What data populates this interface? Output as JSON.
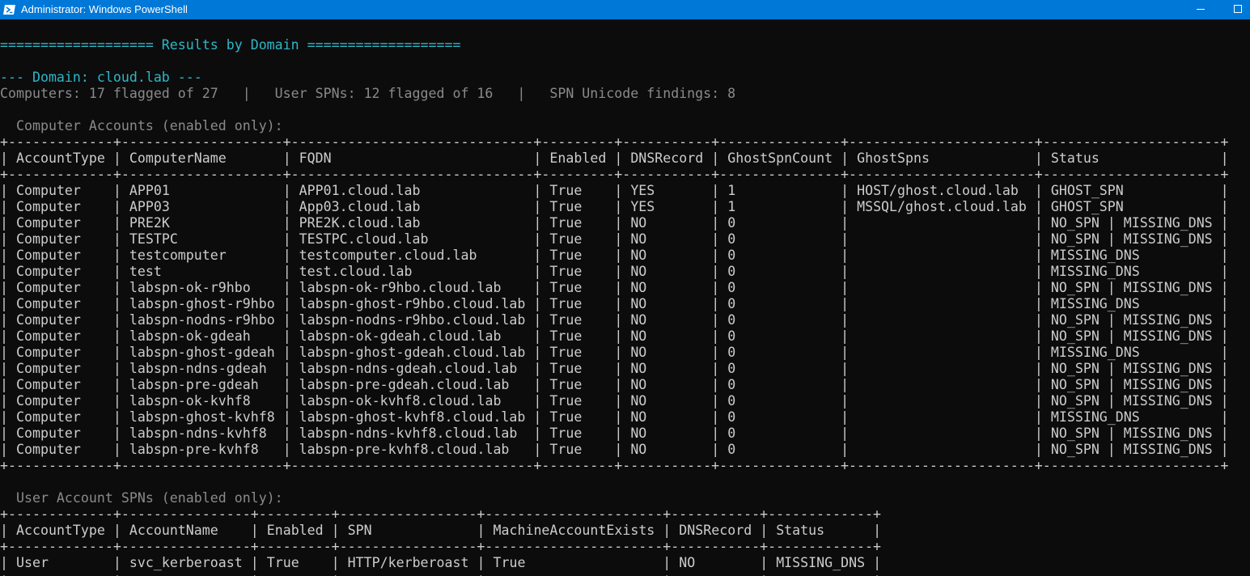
{
  "window": {
    "title": "Administrator: Windows PowerShell"
  },
  "console": {
    "results_header": "=================== Results by Domain ===================",
    "domain_header": "--- Domain: cloud.lab ---",
    "summary": "Computers: 17 flagged of 27   |   User SPNs: 12 flagged of 16   |   SPN Unicode findings: 8",
    "computer_section_title": "  Computer Accounts (enabled only):",
    "user_section_title": "  User Account SPNs (enabled only):",
    "computer_table": {
      "headers": [
        "AccountType",
        "ComputerName",
        "FQDN",
        "Enabled",
        "DNSRecord",
        "GhostSpnCount",
        "GhostSpns",
        "Status"
      ],
      "rows": [
        [
          "Computer",
          "APP01",
          "APP01.cloud.lab",
          "True",
          "YES",
          "1",
          "HOST/ghost.cloud.lab",
          "GHOST_SPN"
        ],
        [
          "Computer",
          "APP03",
          "App03.cloud.lab",
          "True",
          "YES",
          "1",
          "MSSQL/ghost.cloud.lab",
          "GHOST_SPN"
        ],
        [
          "Computer",
          "PRE2K",
          "PRE2K.cloud.lab",
          "True",
          "NO",
          "0",
          "",
          "NO_SPN | MISSING_DNS"
        ],
        [
          "Computer",
          "TESTPC",
          "TESTPC.cloud.lab",
          "True",
          "NO",
          "0",
          "",
          "NO_SPN | MISSING_DNS"
        ],
        [
          "Computer",
          "testcomputer",
          "testcomputer.cloud.lab",
          "True",
          "NO",
          "0",
          "",
          "MISSING_DNS"
        ],
        [
          "Computer",
          "test",
          "test.cloud.lab",
          "True",
          "NO",
          "0",
          "",
          "MISSING_DNS"
        ],
        [
          "Computer",
          "labspn-ok-r9hbo",
          "labspn-ok-r9hbo.cloud.lab",
          "True",
          "NO",
          "0",
          "",
          "NO_SPN | MISSING_DNS"
        ],
        [
          "Computer",
          "labspn-ghost-r9hbo",
          "labspn-ghost-r9hbo.cloud.lab",
          "True",
          "NO",
          "0",
          "",
          "MISSING_DNS"
        ],
        [
          "Computer",
          "labspn-nodns-r9hbo",
          "labspn-nodns-r9hbo.cloud.lab",
          "True",
          "NO",
          "0",
          "",
          "NO_SPN | MISSING_DNS"
        ],
        [
          "Computer",
          "labspn-ok-gdeah",
          "labspn-ok-gdeah.cloud.lab",
          "True",
          "NO",
          "0",
          "",
          "NO_SPN | MISSING_DNS"
        ],
        [
          "Computer",
          "labspn-ghost-gdeah",
          "labspn-ghost-gdeah.cloud.lab",
          "True",
          "NO",
          "0",
          "",
          "MISSING_DNS"
        ],
        [
          "Computer",
          "labspn-ndns-gdeah",
          "labspn-ndns-gdeah.cloud.lab",
          "True",
          "NO",
          "0",
          "",
          "NO_SPN | MISSING_DNS"
        ],
        [
          "Computer",
          "labspn-pre-gdeah",
          "labspn-pre-gdeah.cloud.lab",
          "True",
          "NO",
          "0",
          "",
          "NO_SPN | MISSING_DNS"
        ],
        [
          "Computer",
          "labspn-ok-kvhf8",
          "labspn-ok-kvhf8.cloud.lab",
          "True",
          "NO",
          "0",
          "",
          "NO_SPN | MISSING_DNS"
        ],
        [
          "Computer",
          "labspn-ghost-kvhf8",
          "labspn-ghost-kvhf8.cloud.lab",
          "True",
          "NO",
          "0",
          "",
          "MISSING_DNS"
        ],
        [
          "Computer",
          "labspn-ndns-kvhf8",
          "labspn-ndns-kvhf8.cloud.lab",
          "True",
          "NO",
          "0",
          "",
          "NO_SPN | MISSING_DNS"
        ],
        [
          "Computer",
          "labspn-pre-kvhf8",
          "labspn-pre-kvhf8.cloud.lab",
          "True",
          "NO",
          "0",
          "",
          "NO_SPN | MISSING_DNS"
        ]
      ]
    },
    "user_table": {
      "headers": [
        "AccountType",
        "AccountName",
        "Enabled",
        "SPN",
        "MachineAccountExists",
        "DNSRecord",
        "Status"
      ],
      "rows": [
        [
          "User",
          "svc_kerberoast",
          "True",
          "HTTP/kerberoast",
          "True",
          "NO",
          "MISSING_DNS"
        ]
      ]
    }
  },
  "colors": {
    "titlebar": "#0078d7",
    "background": "#0c0c0c",
    "accent_text": "#2fb7c8",
    "dim_text": "#8a8a8a",
    "normal_text": "#cccccc"
  },
  "icons": {
    "app": "powershell-icon",
    "minimize": "minimize-icon",
    "maximize": "maximize-icon"
  }
}
